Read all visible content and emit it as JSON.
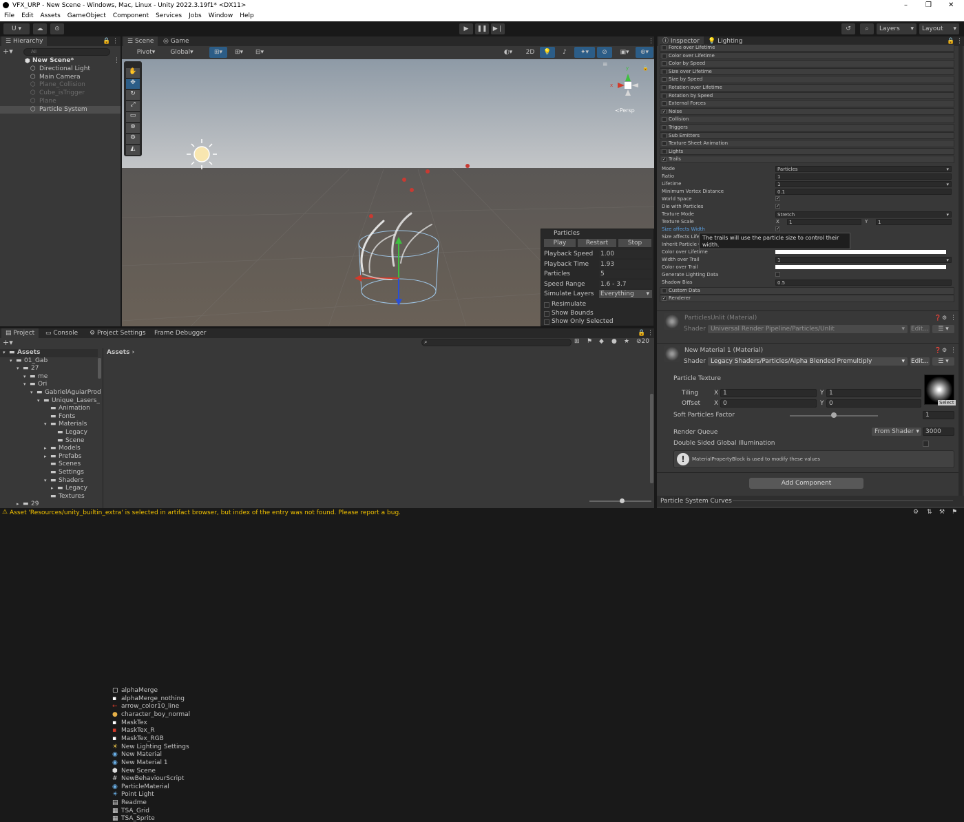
{
  "window": {
    "title": "VFX_URP - New Scene - Windows, Mac, Linux - Unity 2022.3.19f1* <DX11>",
    "minimize": "–",
    "maximize": "❐",
    "close": "✕"
  },
  "menu": [
    "File",
    "Edit",
    "Assets",
    "GameObject",
    "Component",
    "Services",
    "Jobs",
    "Window",
    "Help"
  ],
  "toolbar": {
    "account": "U ▾",
    "layers": "Layers",
    "layout": "Layout"
  },
  "hierarchy": {
    "tab": "Hierarchy",
    "search_placeholder": "All",
    "scene": "New Scene*",
    "items": [
      {
        "label": "Directional Light",
        "dim": false
      },
      {
        "label": "Main Camera",
        "dim": false
      },
      {
        "label": "Plane_Collision",
        "dim": true
      },
      {
        "label": "Cube_isTrigger",
        "dim": true
      },
      {
        "label": "Plane",
        "dim": true
      },
      {
        "label": "Particle System",
        "dim": false
      }
    ]
  },
  "scene": {
    "tabs": [
      "Scene",
      "Game"
    ],
    "pivot": "Pivot",
    "global": "Global",
    "btn2d": "2D",
    "persp": "≺Persp"
  },
  "particles_overlay": {
    "title": "Particles",
    "play": "Play",
    "restart": "Restart",
    "stop": "Stop",
    "rows": [
      {
        "label": "Playback Speed",
        "value": "1.00"
      },
      {
        "label": "Playback Time",
        "value": "1.93"
      },
      {
        "label": "Particles",
        "value": "5"
      },
      {
        "label": "Speed Range",
        "value": "1.6 - 3.7"
      },
      {
        "label": "Simulate Layers",
        "value": "Everything"
      }
    ],
    "toggles": [
      "Resimulate",
      "Show Bounds",
      "Show Only Selected"
    ]
  },
  "inspector": {
    "tabs": [
      "Inspector",
      "Lighting"
    ],
    "modules": [
      {
        "label": "Force over Lifetime",
        "checked": false
      },
      {
        "label": "Color over Lifetime",
        "checked": false
      },
      {
        "label": "Color by Speed",
        "checked": false
      },
      {
        "label": "Size over Lifetime",
        "checked": false
      },
      {
        "label": "Size by Speed",
        "checked": false
      },
      {
        "label": "Rotation over Lifetime",
        "checked": false
      },
      {
        "label": "Rotation by Speed",
        "checked": false
      },
      {
        "label": "External Forces",
        "checked": false
      },
      {
        "label": "Noise",
        "checked": true
      },
      {
        "label": "Collision",
        "checked": false
      },
      {
        "label": "Triggers",
        "checked": false
      },
      {
        "label": "Sub Emitters",
        "checked": false
      },
      {
        "label": "Texture Sheet Animation",
        "checked": false
      },
      {
        "label": "Lights",
        "checked": false
      },
      {
        "label": "Trails",
        "checked": true
      }
    ],
    "trails": {
      "mode_label": "Mode",
      "mode": "Particles",
      "ratio_label": "Ratio",
      "ratio": "1",
      "lifetime_label": "Lifetime",
      "lifetime": "1",
      "mvd_label": "Minimum Vertex Distance",
      "mvd": "0.1",
      "world_space": "World Space",
      "die_with": "Die with Particles",
      "texture_mode_label": "Texture Mode",
      "texture_mode": "Stretch",
      "texture_scale_label": "Texture Scale",
      "tsx": "1",
      "tsy": "1",
      "x": "X",
      "y": "Y",
      "size_affects_width": "Size affects Width",
      "size_affects_lifetime": "Size affects Lifetime",
      "inherit": "Inherit Particle Color",
      "col_life": "Color over Lifetime",
      "width_trail": "Width over Trail",
      "width_trail_value": "1",
      "col_trail": "Color over Trail",
      "gen_light": "Generate Lighting Data",
      "shadow_bias_label": "Shadow Bias",
      "shadow_bias": "0.5"
    },
    "tooltip": "The trails will use the particle size to control their width.",
    "custom_data": "Custom Data",
    "renderer": "Renderer",
    "mat1": {
      "name": "ParticlesUnlit (Material)",
      "shader_label": "Shader",
      "shader": "Universal Render Pipeline/Particles/Unlit",
      "edit": "Edit..."
    },
    "mat2": {
      "name": "New Material 1 (Material)",
      "shader_label": "Shader",
      "shader": "Legacy Shaders/Particles/Alpha Blended Premultiply",
      "edit": "Edit..."
    },
    "props": {
      "texture": "Particle Texture",
      "tiling": "Tiling",
      "offset": "Offset",
      "tx": "1",
      "ty": "1",
      "ox": "0",
      "oy": "0",
      "select": "Select",
      "soft": "Soft Particles Factor",
      "soft_val": "1",
      "soft_pct": 0.5,
      "rq": "Render Queue",
      "rq_mode": "From Shader",
      "rq_val": "3000",
      "dsgi": "Double Sided Global Illumination",
      "info": "MaterialPropertyBlock is used to modify these values"
    },
    "add_component": "Add Component",
    "curves": "Particle System Curves"
  },
  "project": {
    "tabs": [
      "Project",
      "Console",
      "Project Settings",
      "Frame Debugger"
    ],
    "badge": "20",
    "tree": [
      {
        "label": "Assets",
        "level": 0
      },
      {
        "label": "01_Gab",
        "level": 1
      },
      {
        "label": "27",
        "level": 2
      },
      {
        "label": "me",
        "level": 3
      },
      {
        "label": "Ori",
        "level": 3
      },
      {
        "label": "GabrielAguiarProd",
        "level": 4
      },
      {
        "label": "Unique_Lasers_",
        "level": 5
      },
      {
        "label": "Animation",
        "level": 6
      },
      {
        "label": "Fonts",
        "level": 6
      },
      {
        "label": "Materials",
        "level": 6
      },
      {
        "label": "Legacy",
        "level": 7
      },
      {
        "label": "Scene",
        "level": 7
      },
      {
        "label": "Models",
        "level": 6
      },
      {
        "label": "Prefabs",
        "level": 6
      },
      {
        "label": "Scenes",
        "level": 6
      },
      {
        "label": "Settings",
        "level": 6
      },
      {
        "label": "Shaders",
        "level": 6
      },
      {
        "label": "Legacy",
        "level": 7
      },
      {
        "label": "Textures",
        "level": 6
      },
      {
        "label": "29",
        "level": 2
      }
    ],
    "breadcrumb": "Assets",
    "files": [
      "alphaMerge",
      "alphaMerge_nothing",
      "arrow_color10_line",
      "character_boy_normal",
      "MaskTex",
      "MaskTex_R",
      "MaskTex_RGB",
      "New Lighting Settings",
      "New Material",
      "New Material 1",
      "New Scene",
      "NewBehaviourScript",
      "ParticleMaterial",
      "Point Light",
      "Readme",
      "TSA_Grid",
      "TSA_Sprite"
    ]
  },
  "status": {
    "warning": "Asset 'Resources/unity_builtin_extra' is selected in artifact browser, but index of the entry was not found. Please report a bug."
  },
  "colors": {
    "accent": "#2c5d87",
    "panel": "#383838",
    "dark": "#191919"
  }
}
